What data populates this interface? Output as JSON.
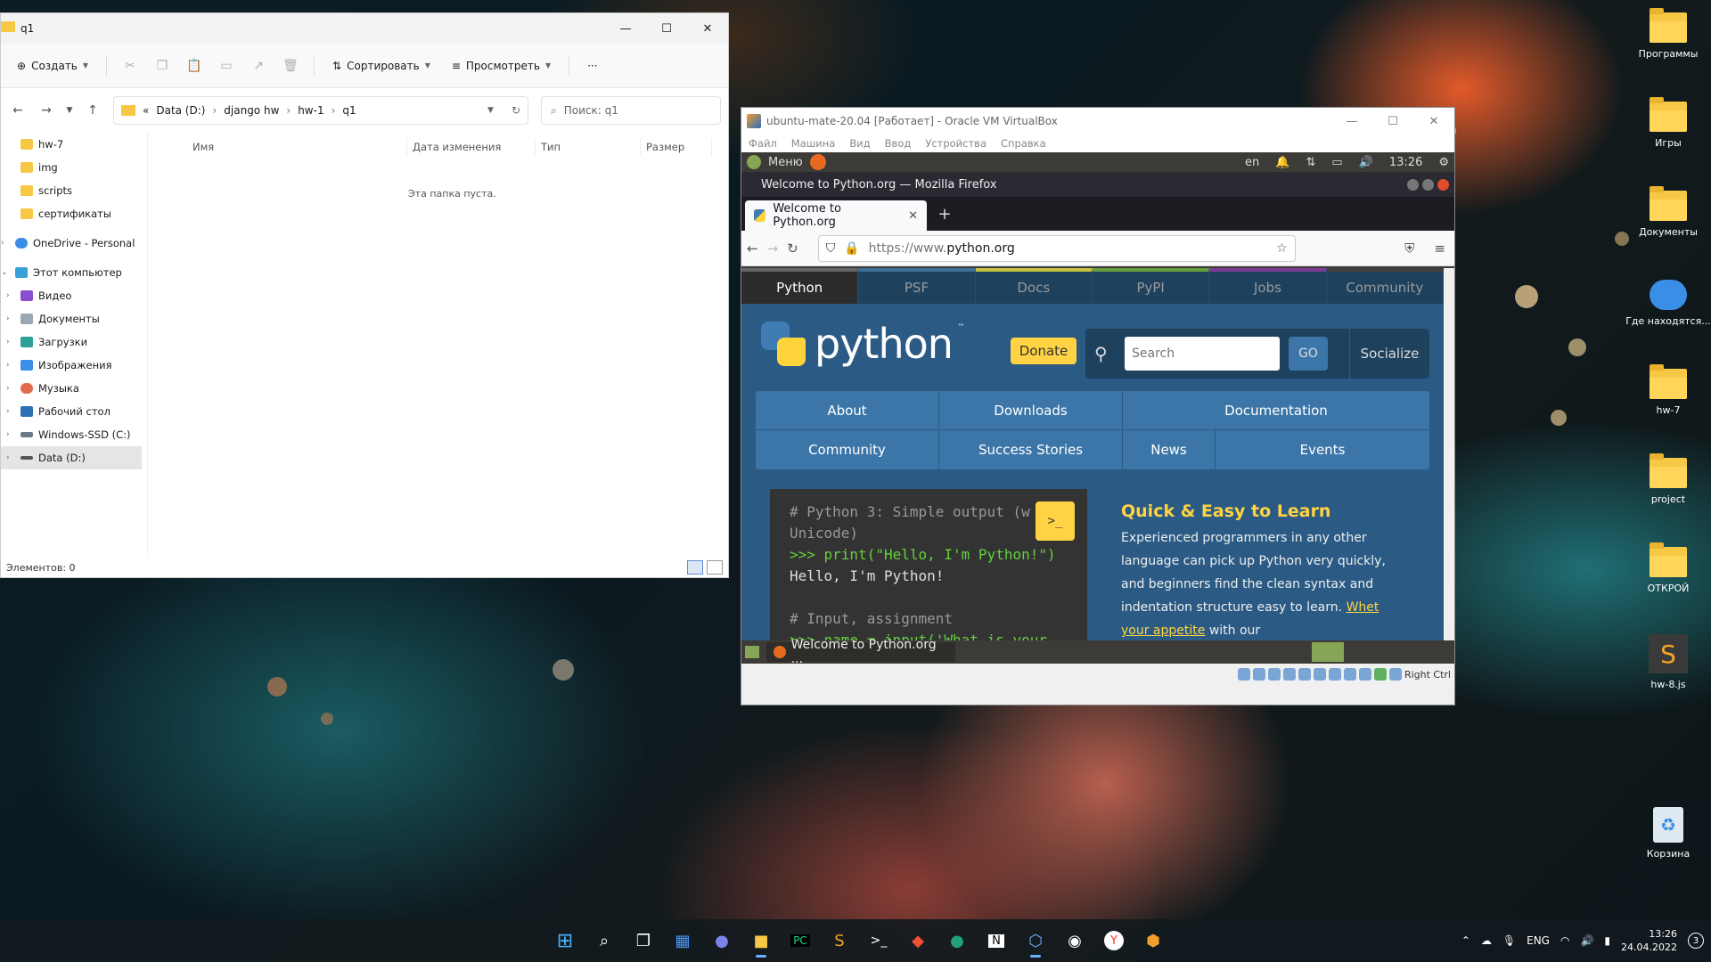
{
  "desktop": {
    "icons": [
      {
        "label": "Программы",
        "kind": "folder"
      },
      {
        "label": "Игры",
        "kind": "folder"
      },
      {
        "label": "Документы",
        "kind": "folder"
      },
      {
        "label": "Где находятся...",
        "kind": "onedrive"
      },
      {
        "label": "hw-7",
        "kind": "folder"
      },
      {
        "label": "project",
        "kind": "folder"
      },
      {
        "label": "ОТКРОЙ",
        "kind": "folder"
      },
      {
        "label": "hw-8.js",
        "kind": "file"
      },
      {
        "label": "Корзина",
        "kind": "recycle-bin"
      }
    ]
  },
  "explorer": {
    "title": "q1",
    "toolbar": {
      "create": "Создать",
      "sort": "Сортировать",
      "view": "Просмотреть",
      "more": "···"
    },
    "breadcrumb": [
      "Data (D:)",
      "django hw",
      "hw-1",
      "q1"
    ],
    "breadcrumb_prefix": "«",
    "search_placeholder": "Поиск: q1",
    "nav": [
      {
        "label": "hw-7",
        "icon": "folder-icon"
      },
      {
        "label": "img",
        "icon": "folder-icon"
      },
      {
        "label": "scripts",
        "icon": "folder-icon"
      },
      {
        "label": "сертификаты",
        "icon": "folder-icon"
      },
      {
        "label": "OneDrive - Personal",
        "icon": "cloud-icon"
      },
      {
        "label": "Этот компьютер",
        "icon": "pc-icon"
      },
      {
        "label": "Видео",
        "icon": "video-icon"
      },
      {
        "label": "Документы",
        "icon": "documents-icon"
      },
      {
        "label": "Загрузки",
        "icon": "download-icon"
      },
      {
        "label": "Изображения",
        "icon": "pictures-icon"
      },
      {
        "label": "Музыка",
        "icon": "music-icon"
      },
      {
        "label": "Рабочий стол",
        "icon": "desktop-icon"
      },
      {
        "label": "Windows-SSD (C:)",
        "icon": "drive-icon"
      },
      {
        "label": "Data (D:)",
        "icon": "drive-icon"
      }
    ],
    "columns": [
      "Имя",
      "Дата изменения",
      "Тип",
      "Размер"
    ],
    "empty_message": "Эта папка пуста.",
    "status": "Элементов: 0"
  },
  "vbox": {
    "title": "ubuntu-mate-20.04 [Работает] - Oracle VM VirtualBox",
    "menu": [
      "Файл",
      "Машина",
      "Вид",
      "Ввод",
      "Устройства",
      "Справка"
    ],
    "status_right": "Right Ctrl"
  },
  "guest": {
    "panel": {
      "menu": "Меню",
      "lang": "en",
      "time": "13:26"
    },
    "firefox": {
      "window_title": "Welcome to Python.org — Mozilla Firefox",
      "tab_title": "Welcome to Python.org",
      "url_scheme": "https://www.",
      "url_host": "python.org"
    },
    "taskbar_item": "Welcome to Python.org ..."
  },
  "python_org": {
    "topnav": [
      {
        "label": "Python",
        "color": "#646565"
      },
      {
        "label": "PSF",
        "color": "#3e6e94"
      },
      {
        "label": "Docs",
        "color": "#c9c43e"
      },
      {
        "label": "PyPI",
        "color": "#68a03d"
      },
      {
        "label": "Jobs",
        "color": "#7b3e94"
      },
      {
        "label": "Community",
        "color": "#3e3e3e"
      }
    ],
    "logo_word": "python",
    "tm": "™",
    "donate": "Donate",
    "search_placeholder": "Search",
    "go": "GO",
    "socialize": "Socialize",
    "mainnav_row1": [
      "About",
      "Downloads",
      "Documentation"
    ],
    "mainnav_row2": [
      "Community",
      "Success Stories",
      "News",
      "Events"
    ],
    "code": [
      {
        "type": "c",
        "text": "# Python 3: Simple output (w"
      },
      {
        "type": "c",
        "text": "Unicode)"
      },
      {
        "type": "p",
        "text": ">>> print(\"Hello, I'm Python!\")"
      },
      {
        "type": "o",
        "text": "Hello, I'm Python!"
      },
      {
        "type": "o",
        "text": ""
      },
      {
        "type": "c",
        "text": "# Input, assignment"
      },
      {
        "type": "p",
        "text": ">>> name = input('What is your"
      }
    ],
    "shell_label": ">_",
    "learn_title": "Quick & Easy to Learn",
    "learn_text": "Experienced programmers in any other language can pick up Python very quickly, and beginners find the clean syntax and indentation structure easy to learn.",
    "learn_link": "Whet your appetite",
    "learn_tail": " with our"
  },
  "taskbar": {
    "lang": "ENG",
    "time": "13:26",
    "date": "24.04.2022",
    "notifications": "3"
  }
}
